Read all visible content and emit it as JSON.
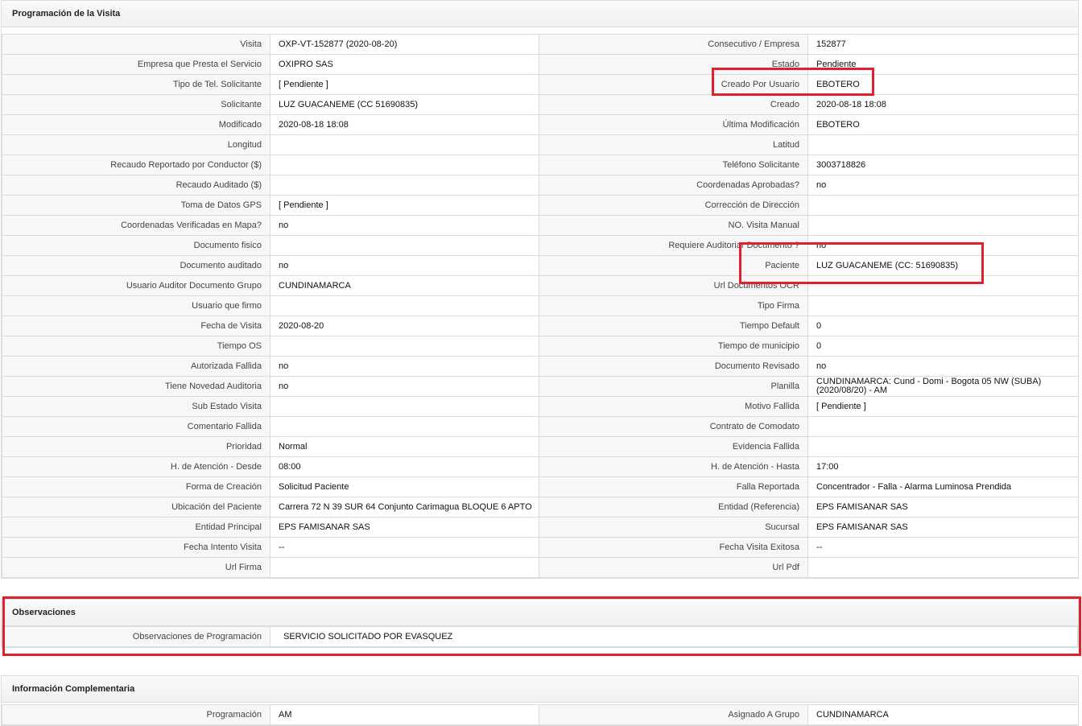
{
  "programacion": {
    "title": "Programación de la Visita",
    "rows": [
      {
        "l1": "Visita",
        "v1": "OXP-VT-152877 (2020-08-20)",
        "l2": "Consecutivo / Empresa",
        "v2": "152877"
      },
      {
        "l1": "Empresa que Presta el Servicio",
        "v1": "OXIPRO SAS",
        "l2": "Estado",
        "v2": "Pendiente"
      },
      {
        "l1": "Tipo de Tel. Solicitante",
        "v1": "[ Pendiente ]",
        "l2": "Creado Por Usuario",
        "v2": "EBOTERO"
      },
      {
        "l1": "Solicitante",
        "v1": "LUZ GUACANEME (CC 51690835)",
        "l2": "Creado",
        "v2": "2020-08-18 18:08"
      },
      {
        "l1": "Modificado",
        "v1": "2020-08-18 18:08",
        "l2": "Última Modificación",
        "v2": " EBOTERO"
      },
      {
        "l1": "Longitud",
        "v1": "",
        "l2": "Latitud",
        "v2": ""
      },
      {
        "l1": "Recaudo Reportado por Conductor ($)",
        "v1": "",
        "l2": "Teléfono Solicitante",
        "v2": "3003718826"
      },
      {
        "l1": "Recaudo Auditado ($)",
        "v1": "",
        "l2": "Coordenadas Aprobadas?",
        "v2": " no"
      },
      {
        "l1": "Toma de Datos GPS",
        "v1": "[ Pendiente ]",
        "l2": "Corrección de Dirección",
        "v2": ""
      },
      {
        "l1": "Coordenadas Verificadas en Mapa?",
        "v1": " no",
        "l2": "NO. Visita Manual",
        "v2": ""
      },
      {
        "l1": "Documento fisico",
        "v1": "",
        "l2": "Requiere Auditoriar Documento ?",
        "v2": " no"
      },
      {
        "l1": "Documento auditado",
        "v1": " no",
        "l2": "Paciente",
        "v2": "LUZ GUACANEME (CC: 51690835)"
      },
      {
        "l1": "Usuario Auditor Documento Grupo",
        "v1": "CUNDINAMARCA",
        "l2": "Url Documentos OCR",
        "v2": ""
      },
      {
        "l1": "Usuario que firmo",
        "v1": "",
        "l2": "Tipo Firma",
        "v2": ""
      },
      {
        "l1": "Fecha de Visita",
        "v1": " 2020-08-20",
        "l2": "Tiempo Default",
        "v2": "0"
      },
      {
        "l1": "Tiempo OS",
        "v1": "",
        "l2": "Tiempo de municipio",
        "v2": "0"
      },
      {
        "l1": "Autorizada Fallida",
        "v1": " no",
        "l2": "Documento Revisado",
        "v2": " no"
      },
      {
        "l1": "Tiene Novedad Auditoria",
        "v1": " no",
        "l2": "Planilla",
        "v2": "CUNDINAMARCA: Cund - Domi - Bogota 05 NW (SUBA) (2020/08/20) - AM"
      },
      {
        "l1": "Sub Estado Visita",
        "v1": "",
        "l2": "Motivo Fallida",
        "v2": "[ Pendiente ]"
      },
      {
        "l1": "Comentario Fallida",
        "v1": "",
        "l2": "Contrato de Comodato",
        "v2": ""
      },
      {
        "l1": "Prioridad",
        "v1": "Normal",
        "l2": "Evidencia Fallida",
        "v2": ""
      },
      {
        "l1": "H. de Atención - Desde",
        "v1": "08:00",
        "l2": "H. de Atención - Hasta",
        "v2": "17:00"
      },
      {
        "l1": "Forma de Creación",
        "v1": "Solicitud Paciente",
        "l2": "Falla Reportada",
        "v2": "Concentrador - Falla - Alarma Luminosa Prendida"
      },
      {
        "l1": "Ubicación del Paciente",
        "v1": "Carrera 72 N 39 SUR 64 Conjunto Carimagua BLOQUE 6 APTO",
        "l2": "Entidad (Referencia)",
        "v2": "EPS FAMISANAR SAS"
      },
      {
        "l1": "Entidad Principal",
        "v1": "EPS FAMISANAR SAS",
        "l2": "Sucursal",
        "v2": "EPS FAMISANAR SAS"
      },
      {
        "l1": "Fecha Intento Visita",
        "v1": " --",
        "l2": "Fecha Visita Exitosa",
        "v2": " --"
      },
      {
        "l1": "Url Firma",
        "v1": "",
        "l2": "Url Pdf",
        "v2": ""
      }
    ]
  },
  "observaciones": {
    "title": "Observaciones",
    "label": "Observaciones de Programación",
    "value": "SERVICIO SOLICITADO POR EVASQUEZ"
  },
  "complementaria": {
    "title": "Información Complementaria",
    "rows": [
      {
        "l1": "Programación",
        "v1": "AM",
        "l2": "Asignado A Grupo",
        "v2": "CUNDINAMARCA"
      }
    ]
  },
  "colors": {
    "highlight": "#e0202a",
    "label_bg": "#f7f7f7",
    "border": "#dcdcdc"
  }
}
